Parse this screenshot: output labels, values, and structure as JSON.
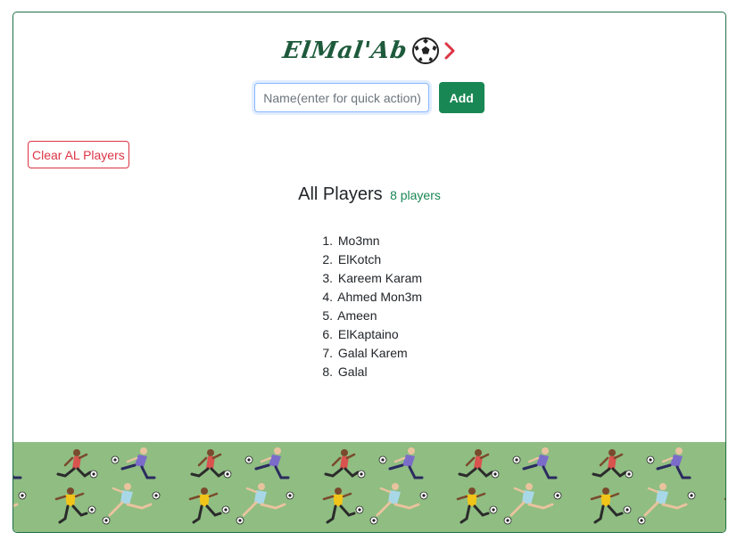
{
  "brand": {
    "logo_text": "ElMal'Ab",
    "logo_icon": "soccer-ball-icon",
    "arrow_icon": "chevron-right-icon"
  },
  "form": {
    "input_value": "",
    "input_placeholder": "Name(enter for quick action)",
    "add_label": "Add"
  },
  "actions": {
    "clear_label": "Clear AL Players"
  },
  "players_section": {
    "title": "All Players",
    "count_label": "8 players",
    "items": [
      {
        "num": "1.",
        "name": "Mo3mn"
      },
      {
        "num": "2.",
        "name": "ElKotch"
      },
      {
        "num": "3.",
        "name": "Kareem Karam"
      },
      {
        "num": "4.",
        "name": "Ahmed Mon3m"
      },
      {
        "num": "5.",
        "name": "Ameen"
      },
      {
        "num": "6.",
        "name": "ElKaptaino"
      },
      {
        "num": "7.",
        "name": "Galal Karem"
      },
      {
        "num": "8.",
        "name": "Galal"
      }
    ]
  },
  "banner": {
    "icon": "soccer-players-pattern"
  },
  "colors": {
    "primary_green": "#198754",
    "danger_red": "#dc3545",
    "banner_green": "#8fbd82",
    "logo_green": "#1e5a3c",
    "border": "#1f6f47"
  }
}
